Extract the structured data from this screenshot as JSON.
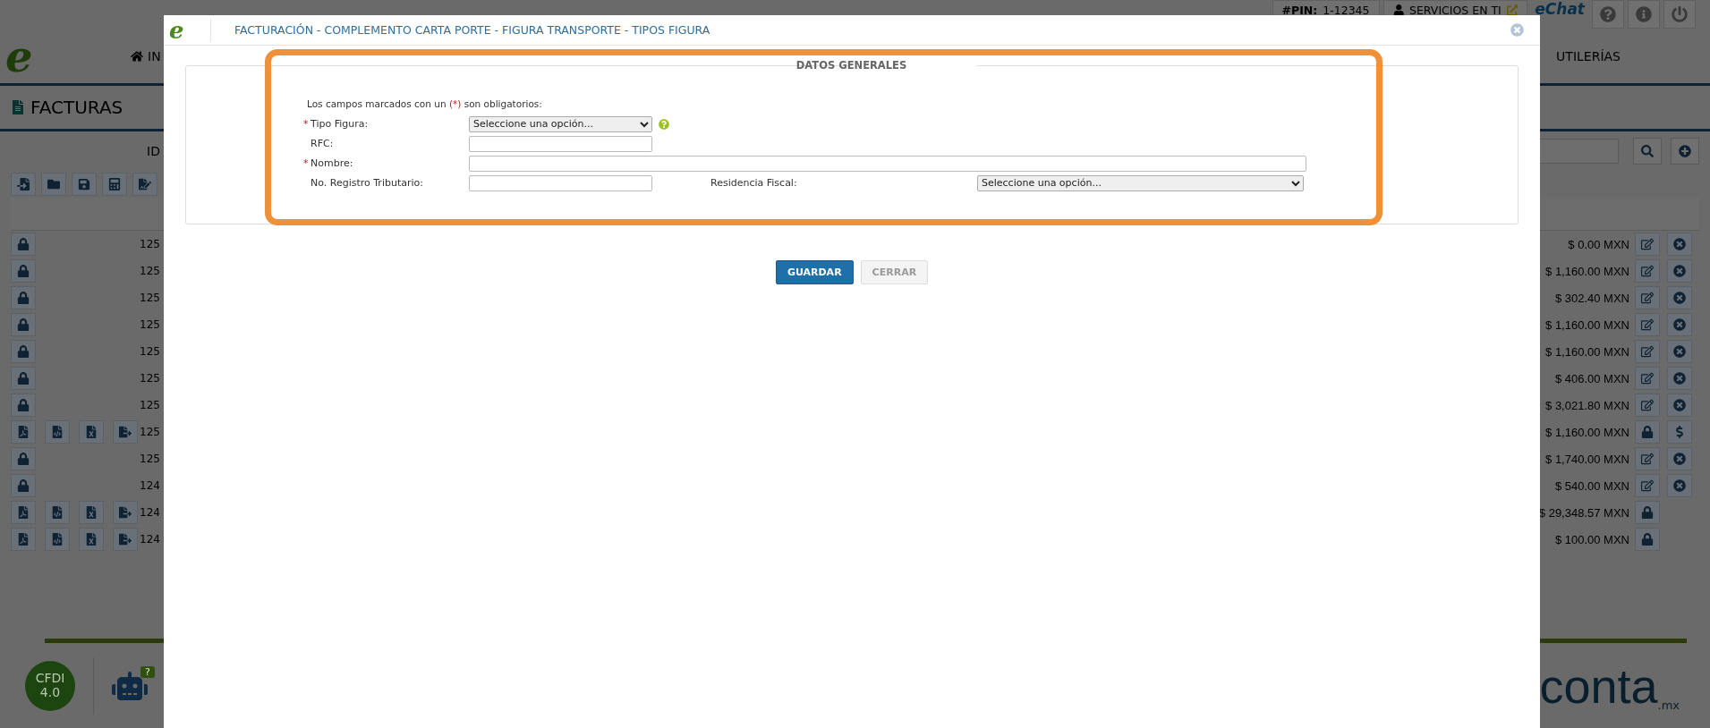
{
  "top_bar": {
    "pin_label": "#PIN:",
    "pin_value": "1-12345",
    "services": "SERVICIOS EN TI",
    "chat_logo": "eChat"
  },
  "logo": "e",
  "nav": [
    "IN",
    "UTILERÍAS"
  ],
  "page_title": "FACTURAS",
  "filter": {
    "label": "ID"
  },
  "rows": [
    {
      "id": "125",
      "amount": "$ 0.00 MXN",
      "kind": "open"
    },
    {
      "id": "125",
      "amount": "$ 1,160.00 MXN",
      "kind": "open"
    },
    {
      "id": "125",
      "amount": "$ 302.40 MXN",
      "kind": "open"
    },
    {
      "id": "125",
      "amount": "$ 1,160.00 MXN",
      "kind": "open"
    },
    {
      "id": "125",
      "amount": "$ 1,160.00 MXN",
      "kind": "open"
    },
    {
      "id": "125",
      "amount": "$ 406.00 MXN",
      "kind": "open"
    },
    {
      "id": "125",
      "amount": "$ 3,021.80 MXN",
      "kind": "open"
    },
    {
      "id": "125",
      "amount": "$ 1,160.00 MXN",
      "kind": "stamped"
    },
    {
      "id": "125",
      "amount": "$ 1,740.00 MXN",
      "kind": "open"
    },
    {
      "id": "124",
      "amount": "$ 540.00 MXN",
      "kind": "open"
    },
    {
      "id": "124",
      "amount": "$ 29,348.57 MXN",
      "kind": "closed"
    },
    {
      "id": "124",
      "amount": "$ 100.00 MXN",
      "kind": "closed"
    }
  ],
  "footer": {
    "badge_lines": [
      "CFDI",
      "4.0"
    ],
    "help_badge": "?",
    "brand": "conta",
    "brand_suffix": ".mx"
  },
  "modal": {
    "logo": "e",
    "title": "FACTURACIÓN - COMPLEMENTO CARTA PORTE - FIGURA TRANSPORTE - TIPOS FIGURA",
    "section": "DATOS GENERALES",
    "note": {
      "before": "Los campos marcados con un ",
      "marker": "(*)",
      "after": " son obligatorios:"
    },
    "required_mark": "*",
    "fields": [
      {
        "label": "Tipo Figura:",
        "required": true,
        "kind": "select",
        "value": "Seleccione una opción...",
        "help": true
      },
      {
        "label": "RFC:",
        "required": false,
        "kind": "text"
      },
      {
        "label": "Nombre:",
        "required": true,
        "kind": "wide"
      },
      {
        "label": "No. Registro Tributario:",
        "required": false,
        "kind": "text",
        "side": {
          "label": "Residencia Fiscal:",
          "value": "Seleccione una opción..."
        }
      }
    ],
    "buttons": [
      {
        "label": "GUARDAR",
        "kind": "primary"
      },
      {
        "label": "CERRAR",
        "kind": "secondary"
      }
    ]
  }
}
